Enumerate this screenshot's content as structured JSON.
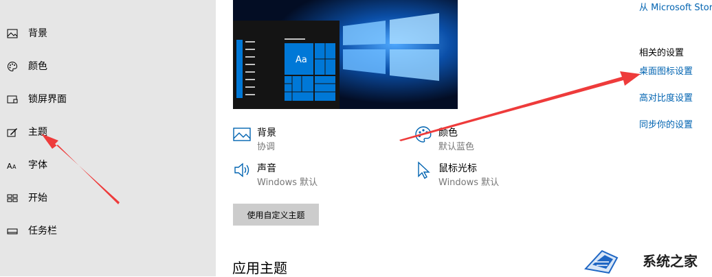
{
  "sidebar": {
    "items": [
      {
        "label": "背景",
        "icon": "picture-icon"
      },
      {
        "label": "颜色",
        "icon": "palette-icon"
      },
      {
        "label": "锁屏界面",
        "icon": "lock-screen-icon"
      },
      {
        "label": "主题",
        "icon": "theme-brush-icon"
      },
      {
        "label": "字体",
        "icon": "font-icon"
      },
      {
        "label": "开始",
        "icon": "start-grid-icon"
      },
      {
        "label": "任务栏",
        "icon": "taskbar-icon"
      }
    ]
  },
  "preview": {
    "tile_text": "Aa"
  },
  "options": {
    "background": {
      "title": "背景",
      "value": "协调",
      "icon": "picture-icon"
    },
    "color": {
      "title": "颜色",
      "value": "默认蓝色",
      "icon": "palette-icon"
    },
    "sound": {
      "title": "声音",
      "value": "Windows 默认",
      "icon": "speaker-icon"
    },
    "cursor": {
      "title": "鼠标光标",
      "value": "Windows 默认",
      "icon": "cursor-icon"
    }
  },
  "custom_theme_button": "使用自定义主题",
  "apply_theme_heading": "应用主题",
  "right": {
    "store_link": "从 Microsoft Store",
    "related_heading": "相关的设置",
    "links": [
      "桌面图标设置",
      "高对比度设置",
      "同步你的设置"
    ]
  },
  "watermark": {
    "text": "系统之家"
  },
  "colors": {
    "accent": "#0063b1",
    "sidebar_bg": "#e6e6e6",
    "arrow": "#ee3b3b",
    "tile_blue": "#0078d7"
  }
}
